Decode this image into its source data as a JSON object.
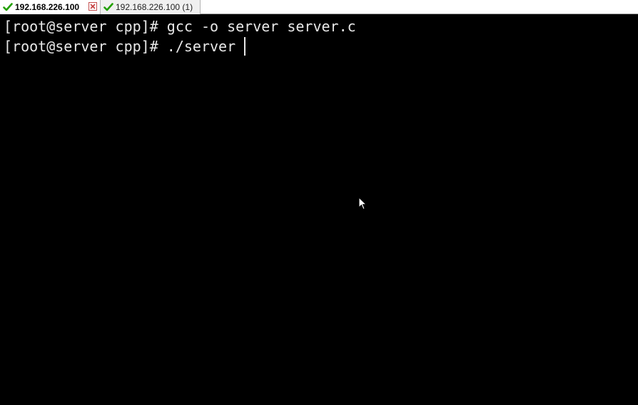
{
  "tabs": [
    {
      "label": "192.168.226.100",
      "status_icon": "check-icon",
      "active": true,
      "closable": true
    },
    {
      "label": "192.168.226.100 (1)",
      "status_icon": "check-icon",
      "active": false
    }
  ],
  "colors": {
    "check": "#22a000",
    "terminal_bg": "#000000",
    "terminal_fg": "#e8e8e8",
    "close": "#c43c3c"
  },
  "terminal": {
    "lines": [
      "[root@server cpp]# gcc -o server server.c",
      "[root@server cpp]# ./server "
    ]
  }
}
